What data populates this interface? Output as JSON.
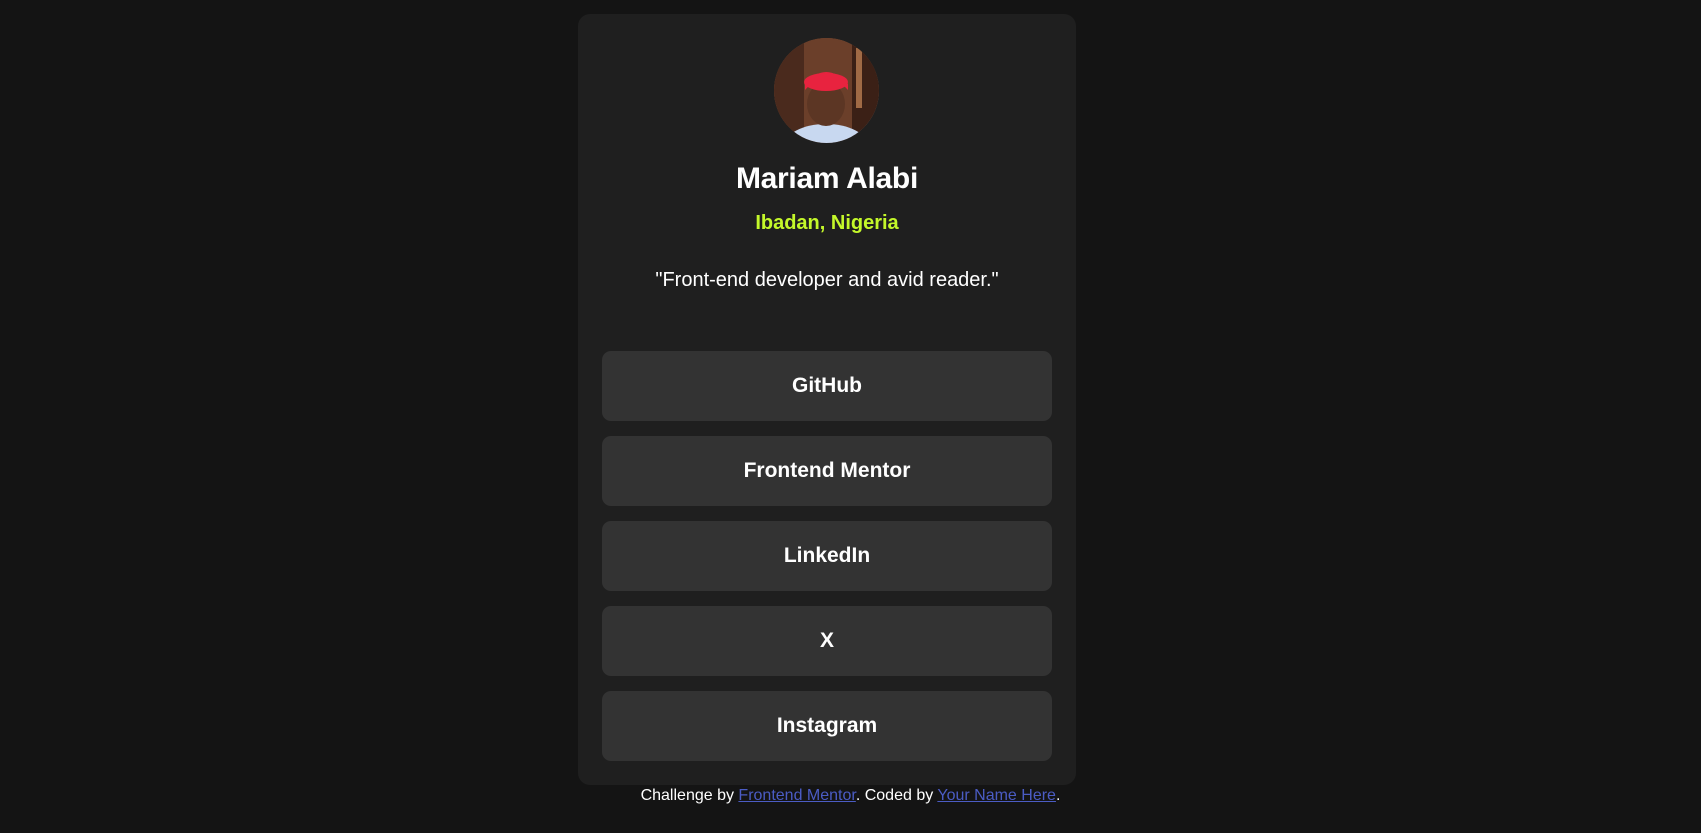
{
  "profile": {
    "name": "Mariam Alabi",
    "location": "Ibadan, Nigeria",
    "bio": "\"Front-end developer and avid reader.\""
  },
  "links": [
    {
      "label": "GitHub"
    },
    {
      "label": "Frontend Mentor"
    },
    {
      "label": "LinkedIn"
    },
    {
      "label": "X"
    },
    {
      "label": "Instagram"
    }
  ],
  "footer": {
    "prefix": "Challenge by ",
    "mentor_link": "Frontend Mentor",
    "middle": ". Coded by ",
    "author_link": "Your Name Here",
    "suffix": "."
  },
  "colors": {
    "background": "#141414",
    "card": "#1f1f1f",
    "button": "#333333",
    "accent": "#c4f82a",
    "link": "#4b5cc4"
  }
}
